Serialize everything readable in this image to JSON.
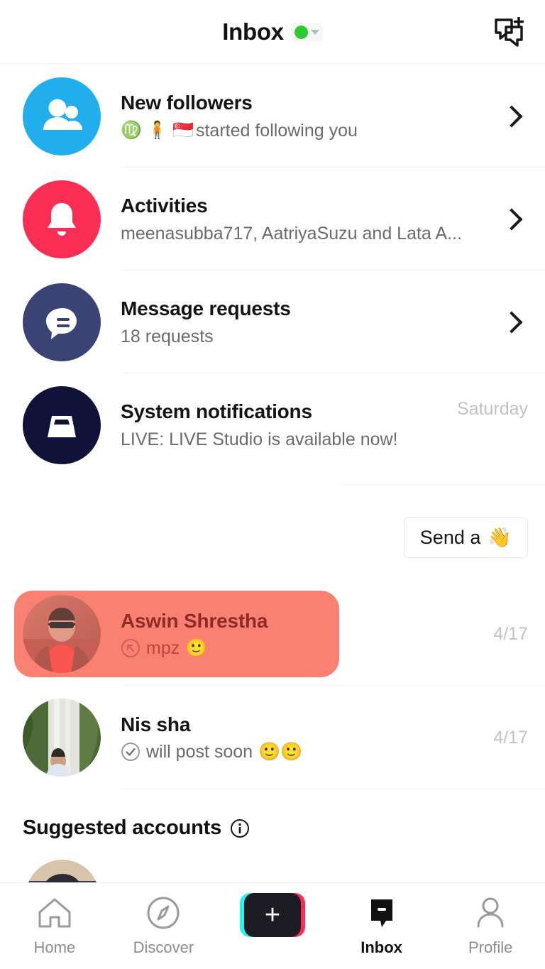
{
  "header": {
    "title": "Inbox",
    "status_icon": "green-status-dot",
    "status_color": "#2ecb2e",
    "caret_icon": "chevron-down-icon",
    "new_message_icon": "new-message-icon"
  },
  "notifications": [
    {
      "id": "new-followers",
      "icon": "people-icon",
      "icon_bg": "#20aeec",
      "title": "New followers",
      "emojis": "♍ 🧍 🇸🇬",
      "subtitle": "started following you",
      "time": "",
      "chevron": "chevron-right-icon"
    },
    {
      "id": "activities",
      "icon": "bell-icon",
      "icon_bg": "#fa2e55",
      "title": "Activities",
      "emojis": "",
      "subtitle": "meenasubba717, AatriyaSuzu and Lata A...",
      "time": "",
      "chevron": "chevron-right-icon"
    },
    {
      "id": "message-requests",
      "icon": "speech-bubble-icon",
      "icon_bg": "#3b4274",
      "title": "Message requests",
      "emojis": "",
      "subtitle": "18 requests",
      "time": "",
      "chevron": "chevron-right-icon"
    },
    {
      "id": "system-notifications",
      "icon": "inbox-tray-icon",
      "icon_bg": "#10123a",
      "title": "System notifications",
      "emojis": "",
      "subtitle": "LIVE: LIVE Studio is available now!",
      "time": "Saturday",
      "chevron": ""
    }
  ],
  "send_wave": {
    "label": "Send a",
    "emoji": "👋",
    "icon": "waving-hand-icon"
  },
  "chats": [
    {
      "id": "aswin-shrestha",
      "name": "Aswin Shrestha",
      "preview": "mpz",
      "preview_emoji": "🙂",
      "status_icon": "sent-arrow-icon",
      "time": "4/17",
      "selected": true,
      "highlight_color": "#fa8072",
      "avatar": "man-in-sunglasses-red-shirt"
    },
    {
      "id": "nis-sha",
      "name": "Nis sha",
      "preview": "will post soon",
      "preview_emoji": "🙂🙂",
      "status_icon": "check-circle-icon",
      "time": "4/17",
      "selected": false,
      "highlight_color": "",
      "avatar": "waterfall-with-person"
    }
  ],
  "suggested": {
    "title": "Suggested accounts",
    "info_icon": "info-circle-icon"
  },
  "bottom_nav": [
    {
      "id": "home",
      "label": "Home",
      "icon": "home-icon",
      "active": false
    },
    {
      "id": "discover",
      "label": "Discover",
      "icon": "compass-icon",
      "active": false
    },
    {
      "id": "create",
      "label": "",
      "icon": "plus-icon",
      "active": false
    },
    {
      "id": "inbox",
      "label": "Inbox",
      "icon": "inbox-filled-icon",
      "active": true
    },
    {
      "id": "profile",
      "label": "Profile",
      "icon": "person-icon",
      "active": false
    }
  ]
}
